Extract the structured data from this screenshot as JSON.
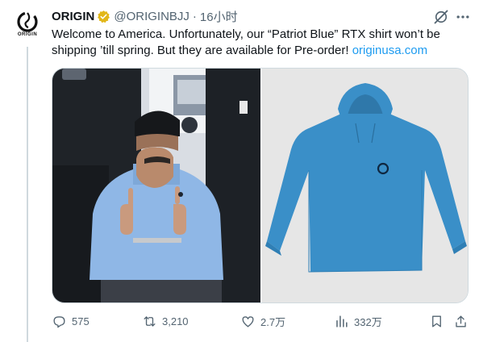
{
  "author": {
    "display_name": "ORIGIN",
    "handle": "@ORIGINBJJ",
    "time": "16小时",
    "avatar_text": "ORIGIN",
    "verified": true
  },
  "tweet": {
    "text_before_link": "Welcome to America. Unfortunately, our “Patriot Blue” RTX shirt won’t be shipping ’till spring. But they are available for Pre-order! ",
    "link_text": "originusa.com"
  },
  "media": {
    "left_image": "photo-of-man-in-blue-hoodie-thumbs-up",
    "right_image": "product-photo-blue-hooded-shirt"
  },
  "actions": {
    "replies": "575",
    "reposts": "3,210",
    "likes": "2.7万",
    "views": "332万"
  },
  "colors": {
    "link": "#1d9bf0",
    "secondary_text": "#536471",
    "verified_gold": "#e2b719",
    "shirt_blue": "#3a8fc8"
  },
  "icons": [
    "grok-icon",
    "more-icon",
    "reply-icon",
    "retweet-icon",
    "like-icon",
    "views-icon",
    "bookmark-icon",
    "share-icon",
    "verified-badge-icon"
  ]
}
